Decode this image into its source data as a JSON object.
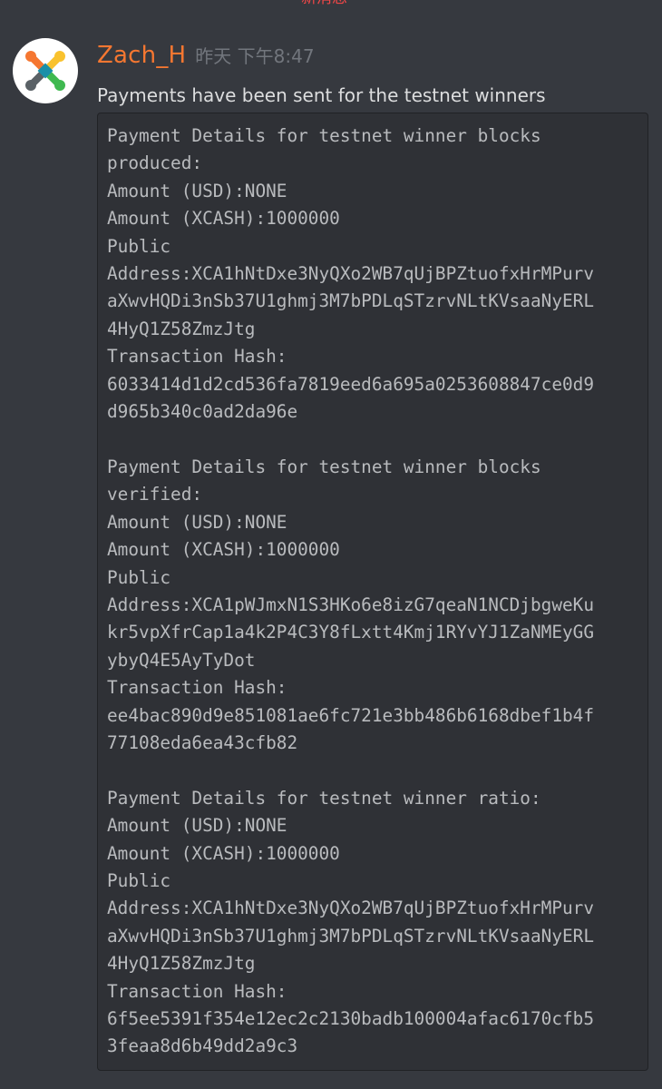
{
  "divider": {
    "new_messages_label": "新消息"
  },
  "message": {
    "author": "Zach_H",
    "timestamp": "昨天 下午8:47",
    "text": "Payments have been sent for the testnet winners",
    "code_lines": [
      "Payment Details for testnet winner blocks",
      "produced:",
      "Amount (USD):NONE",
      "Amount (XCASH):1000000",
      "Public",
      "Address:XCA1hNtDxe3NyQXo2WB7qUjBPZtuofxHrMPurv",
      "aXwvHQDi3nSb37U1ghmj3M7bPDLqSTzrvNLtKVsaaNyERL",
      "4HyQ1Z58ZmzJtg",
      "Transaction Hash:",
      "6033414d1d2cd536fa7819eed6a695a0253608847ce0d9",
      "d965b340c0ad2da96e",
      "",
      "Payment Details for testnet winner blocks",
      "verified:",
      "Amount (USD):NONE",
      "Amount (XCASH):1000000",
      "Public",
      "Address:XCA1pWJmxN1S3HKo6e8izG7qeaN1NCDjbgweKu",
      "kr5vpXfrCap1a4k2P4C3Y8fLxtt4Kmj1RYvYJ1ZaNMEyGG",
      "ybyQ4E5AyTyDot",
      "Transaction Hash:",
      "ee4bac890d9e851081ae6fc721e3bb486b6168dbef1b4f",
      "77108eda6ea43cfb82",
      "",
      "Payment Details for testnet winner ratio:",
      "Amount (USD):NONE",
      "Amount (XCASH):1000000",
      "Public",
      "Address:XCA1hNtDxe3NyQXo2WB7qUjBPZtuofxHrMPurv",
      "aXwvHQDi3nSb37U1ghmj3M7bPDLqSTzrvNLtKVsaaNyERL",
      "4HyQ1Z58ZmzJtg",
      "Transaction Hash:",
      "6f5ee5391f354e12ec2c2130badb100004afac6170cfb5",
      "3feaa8d6b49dd2a9c3"
    ]
  },
  "colors": {
    "background": "#36393f",
    "code_background": "#2f3136",
    "username": "#f57731",
    "new_messages": "#f04747",
    "text": "#dcddde",
    "timestamp": "#72767d",
    "logo_orange": "#f57731",
    "logo_yellow": "#f9c22e",
    "logo_green": "#3fb950",
    "logo_gray": "#5a6166",
    "logo_teal": "#1a8fa8"
  },
  "icons": {
    "avatar": "xcash-logo-icon"
  }
}
